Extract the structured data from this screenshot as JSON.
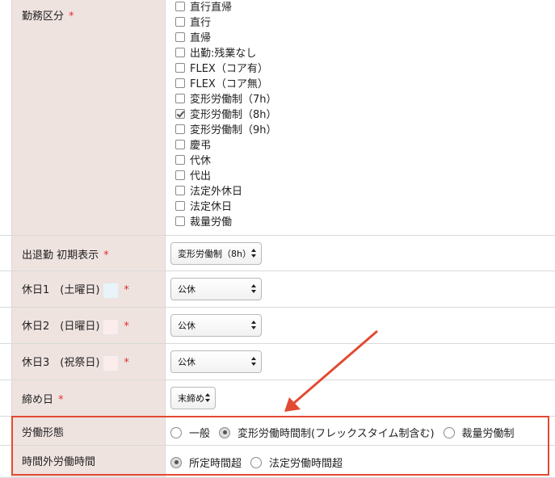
{
  "required_mark": "*",
  "work_category": {
    "label": "勤務区分",
    "options": [
      {
        "label": "直行直帰",
        "checked": false
      },
      {
        "label": "直行",
        "checked": false
      },
      {
        "label": "直帰",
        "checked": false
      },
      {
        "label": "出勤:残業なし",
        "checked": false
      },
      {
        "label": "FLEX（コア有）",
        "checked": false
      },
      {
        "label": "FLEX（コア無）",
        "checked": false
      },
      {
        "label": "変形労働制（7h）",
        "checked": false
      },
      {
        "label": "変形労働制（8h）",
        "checked": true
      },
      {
        "label": "変形労働制（9h）",
        "checked": false
      },
      {
        "label": "慶弔",
        "checked": false
      },
      {
        "label": "代休",
        "checked": false
      },
      {
        "label": "代出",
        "checked": false
      },
      {
        "label": "法定外休日",
        "checked": false
      },
      {
        "label": "法定休日",
        "checked": false
      },
      {
        "label": "裁量労働",
        "checked": false
      }
    ]
  },
  "attendance_default": {
    "label": "出退勤 初期表示",
    "selected": "変形労働制（8h）"
  },
  "holiday1": {
    "label": "休日1　(土曜日)",
    "selected": "公休",
    "color": "#e8f4f8"
  },
  "holiday2": {
    "label": "休日2　(日曜日)",
    "selected": "公休",
    "color": "#fcecec"
  },
  "holiday3": {
    "label": "休日3　(祝祭日)",
    "selected": "公休",
    "color": "#fcecec"
  },
  "closing_day": {
    "label": "締め日",
    "selected": "末締め"
  },
  "labor_type": {
    "label": "労働形態",
    "options": [
      {
        "label": "一般",
        "selected": false
      },
      {
        "label": "変形労働時間制(フレックスタイム制含む)",
        "selected": true
      },
      {
        "label": "裁量労働制",
        "selected": false
      }
    ]
  },
  "overtime": {
    "label": "時間外労働時間",
    "options": [
      {
        "label": "所定時間超",
        "selected": true
      },
      {
        "label": "法定労働時間超",
        "selected": false
      }
    ]
  },
  "annotation_color": "#e24a33"
}
